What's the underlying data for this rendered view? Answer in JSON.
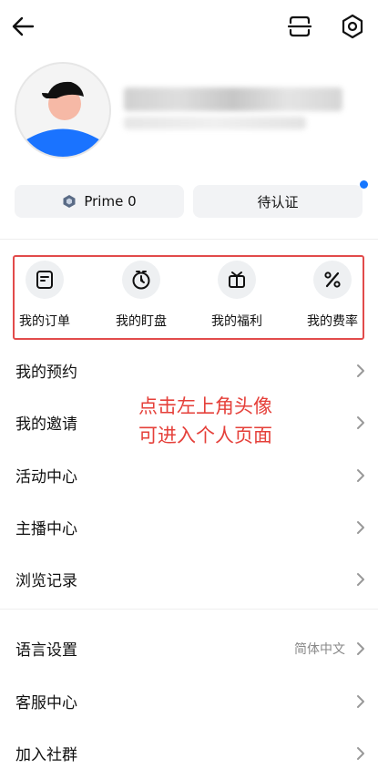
{
  "header": {
    "back_icon": "back-arrow-icon",
    "scan_icon": "scan-icon",
    "settings_icon": "settings-hexagon-icon"
  },
  "profile": {
    "avatar_icon": "avatar-illustration"
  },
  "membership": {
    "prime_label": "Prime 0",
    "verify_label": "待认证",
    "notification_color": "#1677ff"
  },
  "quick_actions": [
    {
      "label": "我的订单",
      "icon": "orders-icon"
    },
    {
      "label": "我的盯盘",
      "icon": "watch-clock-icon"
    },
    {
      "label": "我的福利",
      "icon": "gift-icon"
    },
    {
      "label": "我的费率",
      "icon": "percent-icon"
    }
  ],
  "menu_group_1": [
    {
      "label": "我的预约"
    },
    {
      "label": "我的邀请"
    },
    {
      "label": "活动中心"
    },
    {
      "label": "主播中心"
    },
    {
      "label": "浏览记录"
    }
  ],
  "menu_group_2": [
    {
      "label": "语言设置",
      "value": "简体中文"
    },
    {
      "label": "客服中心"
    },
    {
      "label": "加入社群"
    }
  ],
  "annotation": {
    "text": "点击左上角头像\n可进入个人页面",
    "color": "#e5403a"
  }
}
